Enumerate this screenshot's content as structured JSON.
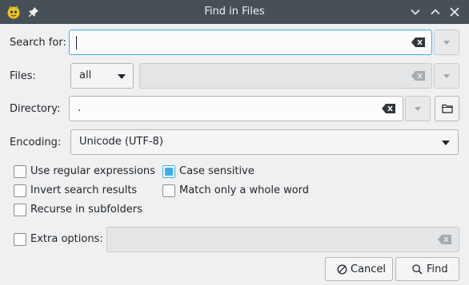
{
  "window": {
    "title": "Find in Files"
  },
  "search": {
    "label": "Search for:",
    "value": ""
  },
  "files": {
    "label": "Files:",
    "filter_value": "all",
    "pattern_value": ""
  },
  "directory": {
    "label": "Directory:",
    "value": "."
  },
  "encoding": {
    "label": "Encoding:",
    "value": "Unicode (UTF-8)"
  },
  "options": {
    "use_regex": {
      "label": "Use regular expressions",
      "checked": false
    },
    "case_sensitive": {
      "label": "Case sensitive",
      "checked": true
    },
    "invert": {
      "label": "Invert search results",
      "checked": false
    },
    "whole_word": {
      "label": "Match only a whole word",
      "checked": false
    },
    "recurse": {
      "label": "Recurse in subfolders",
      "checked": false
    }
  },
  "extra": {
    "label": "Extra options:",
    "value": ""
  },
  "buttons": {
    "cancel": "Cancel",
    "find": "Find"
  },
  "colors": {
    "titlebar": "#475057",
    "accent": "#3daee9",
    "window_bg": "#eff0f1"
  }
}
